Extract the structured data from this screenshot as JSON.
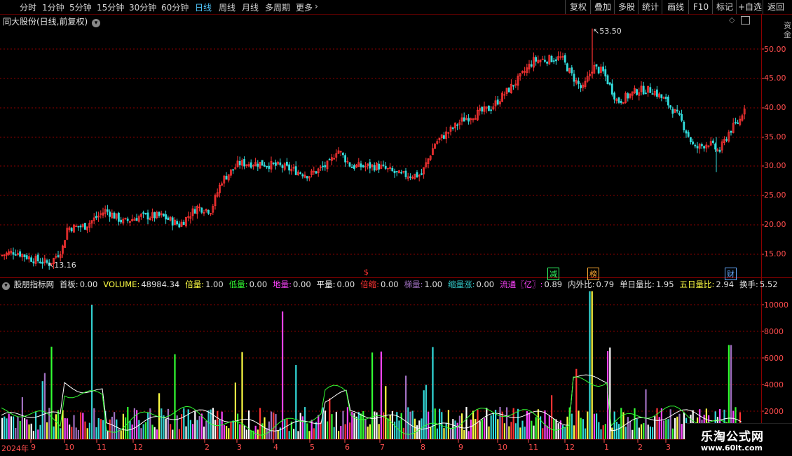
{
  "toolbar": {
    "periods": [
      "分时",
      "1分钟",
      "5分钟",
      "15分钟",
      "30分钟",
      "60分钟",
      "日线",
      "周线",
      "月线",
      "多周期",
      "更多"
    ],
    "active_period": "日线",
    "buttons": [
      "复权",
      "叠加",
      "多股",
      "统计",
      "画线",
      "F10",
      "标记",
      "+自选",
      "返回"
    ]
  },
  "stock_title": "同大股份(日线,前复权)",
  "indicator": {
    "name": "股朋指标网",
    "items": [
      {
        "label": "首板:",
        "value": "0.00",
        "color": "#e0e0e0"
      },
      {
        "label": "VOLUME:",
        "value": "48984.34",
        "color": "#ffff44"
      },
      {
        "label": "倍量:",
        "value": "1.00",
        "color": "#ffff44"
      },
      {
        "label": "低量:",
        "value": "0.00",
        "color": "#33ff33"
      },
      {
        "label": "地量:",
        "value": "0.00",
        "color": "#ff44ff"
      },
      {
        "label": "平量:",
        "value": "0.00",
        "color": "#ffffff"
      },
      {
        "label": "倍缩:",
        "value": "0.00",
        "color": "#ff3333"
      },
      {
        "label": "梯量:",
        "value": "1.00",
        "color": "#a070c0"
      },
      {
        "label": "缩量涨:",
        "value": "0.00",
        "color": "#33cccc"
      },
      {
        "label": "流通〖亿〗:",
        "value": "0.89",
        "color": "#ff44ff"
      },
      {
        "label": "内外比:",
        "value": "0.79",
        "color": "#e0e0e0"
      },
      {
        "label": "单日量比:",
        "value": "1.95",
        "color": "#e0e0e0"
      },
      {
        "label": "五日量比:",
        "value": "2.94",
        "color": "#ffff44"
      },
      {
        "label": "换手:",
        "value": "5.52",
        "color": "#e0e0e0"
      }
    ]
  },
  "price_axis": [
    "50.00",
    "45.00",
    "40.00",
    "35.00",
    "30.00",
    "25.00",
    "20.00",
    "15.00"
  ],
  "volume_axis": [
    "10000",
    "8000",
    "6000",
    "4000",
    "2000"
  ],
  "annotations": {
    "high": "53.50",
    "low": "13.16"
  },
  "x_axis": [
    "2024年",
    "9",
    "10",
    "11",
    "12",
    "2",
    "3",
    "4",
    "5",
    "6",
    "7",
    "8",
    "9",
    "10",
    "11",
    "12",
    "1",
    "2",
    "3"
  ],
  "markers": [
    {
      "text": "$",
      "color": "#ff3333"
    },
    {
      "text": "减",
      "color": "#33ff66"
    },
    {
      "text": "榜",
      "color": "#ffaa33"
    },
    {
      "text": "财",
      "color": "#66aaff"
    }
  ],
  "side_text": "资金",
  "logo": {
    "line1": "乐淘公式网",
    "line2": "www.60lt.com"
  },
  "colors": {
    "up": "#ff3333",
    "down": "#33dddd",
    "grid": "#8b0000",
    "ma": "#ffffff"
  }
}
